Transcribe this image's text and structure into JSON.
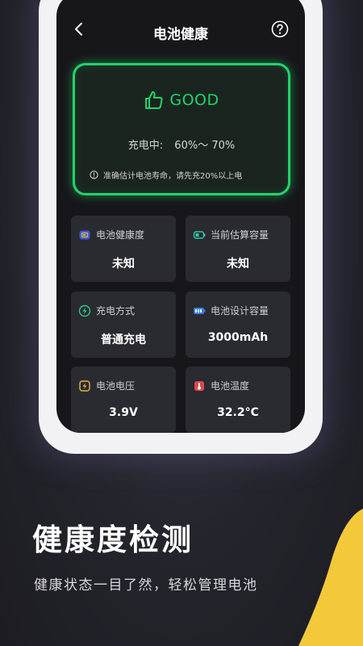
{
  "header": {
    "title": "电池健康"
  },
  "health": {
    "status": "GOOD",
    "charge_label": "充电中:",
    "charge_range": "60%～ 70%",
    "tip": "准确估计电池寿命，请先充20%以上电"
  },
  "tiles": [
    {
      "label": "电池健康度",
      "value": "未知",
      "icon": "battery-health-icon"
    },
    {
      "label": "当前估算容量",
      "value": "未知",
      "icon": "battery-capacity-icon"
    },
    {
      "label": "充电方式",
      "value": "普通充电",
      "icon": "charge-mode-icon"
    },
    {
      "label": "电池设计容量",
      "value": "3000mAh",
      "icon": "battery-design-icon"
    },
    {
      "label": "电池电压",
      "value": "3.9V",
      "icon": "voltage-icon"
    },
    {
      "label": "电池温度",
      "value": "32.2°C",
      "icon": "thermometer-icon"
    }
  ],
  "promo": {
    "headline": "健康度检测",
    "subline": "健康状态一目了然，轻松管理电池"
  },
  "colors": {
    "accent_green": "#22d36a",
    "tile_bg": "#2a2a31",
    "promo_yellow": "#f3c93a"
  }
}
